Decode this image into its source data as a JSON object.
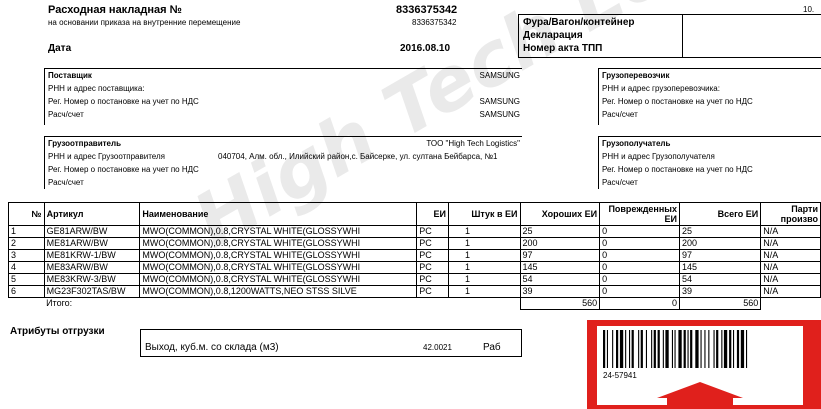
{
  "header": {
    "title": "Расходная накладная №",
    "number": "8336375342",
    "basis_label": "на основании приказа на внутренние перемещение",
    "basis_number": "8336375342",
    "date_label": "Дата",
    "date_value": "2016.08.10",
    "page_marker": "10."
  },
  "transport": {
    "row1": "Фура/Вагон/контейнер",
    "row2": "Декларация",
    "row3": "Номер акта ТПП"
  },
  "supplier": {
    "title": "Поставщик",
    "name": "SAMSUNG",
    "rnn_label": "РНН и адрес поставщика:",
    "vat_label": "Рег. Номер о постановке на учет по НДС",
    "vat_value": "SAMSUNG",
    "account_label": "Расч/счет",
    "account_value": "SAMSUNG"
  },
  "carrier": {
    "title": "Грузоперевозчик",
    "rnn_label": "РНН и адрес грузоперевозчика:",
    "vat_label": "Рег. Номер о постановке на учет по НДС",
    "account_label": "Расч/счет"
  },
  "shipper": {
    "title": "Грузоотправитель",
    "name": "ТОО \"High Tech Logistics\"",
    "rnn_label": "РНН и адрес Грузоотправителя",
    "address": "040704, Алм. обл., Илийский район,с. Байсерке, ул. султана Бейбарса, №1",
    "vat_label": "Рег. Номер о постановке на учет по НДС",
    "account_label": "Расч/счет"
  },
  "consignee": {
    "title": "Грузополучатель",
    "rnn_label": "РНН и адрес Грузополучателя",
    "vat_label": "Рег. Номер о постановке на учет по НДС",
    "account_label": "Расч/счет"
  },
  "table": {
    "headers": {
      "num": "№",
      "article": "Артикул",
      "name": "Наименование",
      "unit": "ЕИ",
      "qty": "Штук в ЕИ",
      "good": "Хороших ЕИ",
      "damaged": "Поврежденных ЕИ",
      "total": "Всего ЕИ",
      "party": "Парти произво"
    },
    "rows": [
      {
        "num": "1",
        "article": "GE81ARW/BW",
        "name": "MWO(COMMON),0.8,CRYSTAL WHITE(GLOSSYWHI",
        "unit": "PC",
        "qty": "1",
        "good": "25",
        "damaged": "0",
        "total": "25",
        "party": "N/A"
      },
      {
        "num": "2",
        "article": "ME81ARW/BW",
        "name": "MWO(COMMON),0.8,CRYSTAL WHITE(GLOSSYWHI",
        "unit": "PC",
        "qty": "1",
        "good": "200",
        "damaged": "0",
        "total": "200",
        "party": "N/A"
      },
      {
        "num": "3",
        "article": "ME81KRW-1/BW",
        "name": "MWO(COMMON),0.8,CRYSTAL WHITE(GLOSSYWHI",
        "unit": "PC",
        "qty": "1",
        "good": "97",
        "damaged": "0",
        "total": "97",
        "party": "N/A"
      },
      {
        "num": "4",
        "article": "ME83ARW/BW",
        "name": "MWO(COMMON),0.8,CRYSTAL WHITE(GLOSSYWHI",
        "unit": "PC",
        "qty": "1",
        "good": "145",
        "damaged": "0",
        "total": "145",
        "party": "N/A"
      },
      {
        "num": "5",
        "article": "ME83KRW-3/BW",
        "name": "MWO(COMMON),0.8,CRYSTAL WHITE(GLOSSYWHI",
        "unit": "PC",
        "qty": "1",
        "good": "54",
        "damaged": "0",
        "total": "54",
        "party": "N/A"
      },
      {
        "num": "6",
        "article": "MG23F302TAS/BW",
        "name": "MWO(COMMON),0.8,1200WATTS,NEO STSS SILVE",
        "unit": "PC",
        "qty": "1",
        "good": "39",
        "damaged": "0",
        "total": "39",
        "party": "N/A"
      }
    ],
    "totals_label": "Итого:",
    "totals_good": "560",
    "totals_damaged": "0",
    "totals_total": "560"
  },
  "attributes": {
    "title": "Атрибуты отгрузки",
    "label": "Выход, куб.м. со склада (м3)",
    "value": "42.0021",
    "unit": "Раб"
  },
  "barcode": {
    "text": "24-57941",
    "frame_color": "#e0201c"
  },
  "watermark": {
    "text": "High Tech Logistics"
  }
}
